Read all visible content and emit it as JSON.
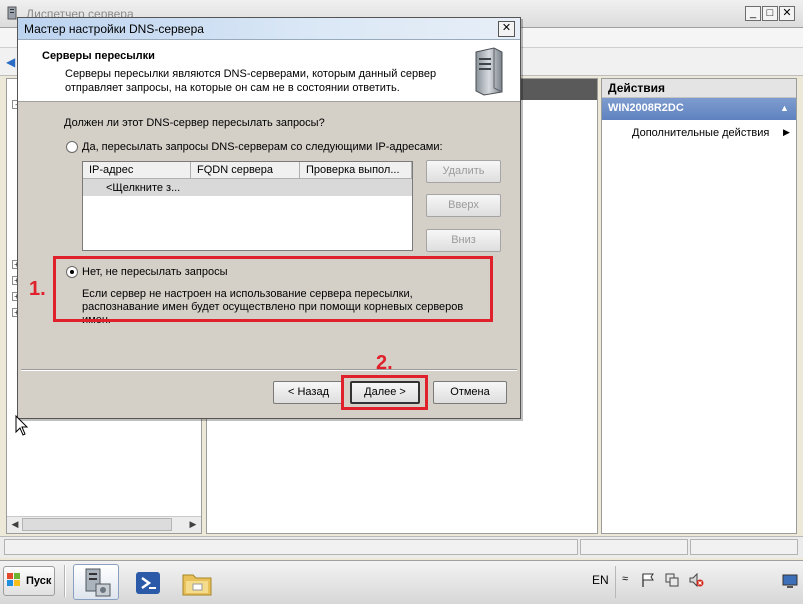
{
  "background_window": {
    "title": "Диспетчер сервера",
    "controls": {
      "minimize": "_",
      "maximize": "□",
      "close": "✕"
    }
  },
  "actions_pane": {
    "header": "Действия",
    "server_name": "WIN2008R2DC",
    "more_actions": "Дополнительные действия"
  },
  "wizard": {
    "title": "Мастер настройки DNS-сервера",
    "close_glyph": "✕",
    "heading": "Серверы пересылки",
    "description": "Серверы пересылки являются DNS-серверами, которым данный сервер отправляет запросы, на которые он сам не в состоянии ответить.",
    "question": "Должен ли этот DNS-сервер пересылать запросы?",
    "option_yes": {
      "label": "Да, пересылать запросы DNS-серверам со следующими IP-адресами:",
      "selected": false
    },
    "ip_table": {
      "columns": [
        "IP-адрес",
        "FQDN сервера",
        "Проверка выпол..."
      ],
      "rows": [
        "<Щелкните з..."
      ]
    },
    "side_buttons": {
      "delete": "Удалить",
      "up": "Вверх",
      "down": "Вниз"
    },
    "option_no": {
      "label": "Нет, не пересылать запросы",
      "selected": true,
      "description": "Если сервер не настроен на использование сервера пересылки, распознавание имен будет осуществлено при помощи корневых серверов имен."
    },
    "nav_buttons": {
      "back": "< Назад",
      "next": "Далее >",
      "cancel": "Отмена"
    }
  },
  "annotations": {
    "step1": "1.",
    "step2": "2."
  },
  "taskbar": {
    "start_label": "Пуск",
    "language": "EN",
    "tray_expand": "≈"
  },
  "colors": {
    "annotation_red": "#e0202a",
    "actions_header_blue": "#6a8cc6"
  }
}
